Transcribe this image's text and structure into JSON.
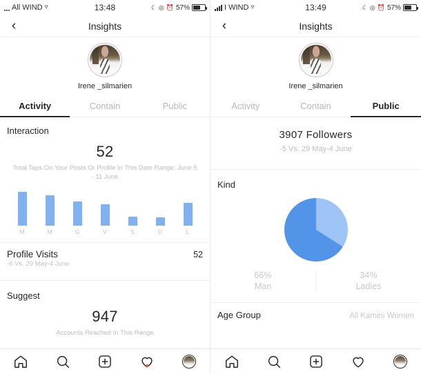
{
  "left": {
    "status": {
      "carrier": "All WIND",
      "wifi_icon": "wifi-icon",
      "time": "13:48",
      "moon_icon": "moon-icon",
      "location_icon": "location-icon",
      "alarm_icon": "alarm-icon",
      "battery_pct": "57%"
    },
    "nav": {
      "back_icon": "chevron-left-icon",
      "title": "Insights"
    },
    "profile": {
      "handle": "Irene _silmarien",
      "avatar_icon": "avatar"
    },
    "tabs": [
      {
        "label": "Activity",
        "active": true
      },
      {
        "label": "Contain",
        "active": false
      },
      {
        "label": "Public",
        "active": false
      }
    ],
    "interaction": {
      "title": "Interaction",
      "value": "52",
      "caption": "Total Taps On Your Posts Or Profile In This Date Range: June 5 - 11 June"
    },
    "profile_visits": {
      "title": "Profile Visits",
      "value": "52",
      "sub": "-6 Vs. 29 May-4 June"
    },
    "suggest": {
      "title": "Suggest",
      "value": "947",
      "caption": "Accounts Reached In This Range"
    }
  },
  "right": {
    "status": {
      "carrier": "I WIND",
      "wifi_icon": "wifi-icon",
      "time": "13:49",
      "moon_icon": "moon-icon",
      "location_icon": "location-icon",
      "alarm_icon": "alarm-icon",
      "battery_pct": "57%"
    },
    "nav": {
      "back_icon": "chevron-left-icon",
      "title": "Insights"
    },
    "profile": {
      "handle": "Irene _silmarien",
      "avatar_icon": "avatar"
    },
    "tabs": [
      {
        "label": "Activity",
        "active": false
      },
      {
        "label": "Contain",
        "active": false
      },
      {
        "label": "Public",
        "active": true
      }
    ],
    "followers": {
      "value": "3907 Followers",
      "sub": "-5 Vs. 29 May-4 June"
    },
    "kind": {
      "title": "Kind"
    },
    "legend": [
      {
        "pct": "66%",
        "label": "Man"
      },
      {
        "pct": "34%",
        "label": "Ladies"
      }
    ],
    "age_group": {
      "title": "Age Group",
      "value": "All Kamini Women"
    }
  },
  "tabbar": {
    "items": [
      {
        "icon": "home-icon",
        "badge": false
      },
      {
        "icon": "search-icon",
        "badge": false
      },
      {
        "icon": "add-post-icon",
        "badge": false
      },
      {
        "icon": "heart-icon",
        "badge": true
      },
      {
        "icon": "profile-avatar-icon",
        "badge": false
      }
    ]
  },
  "colors": {
    "bar_blue": "#7fb2ef",
    "pie_dark": "#5294e8",
    "pie_light": "#9dc4f5",
    "text_primary": "#262626",
    "text_muted": "#c4c4c4",
    "badge_red": "#e8563f"
  },
  "chart_data": [
    {
      "type": "bar",
      "title": "Interaction",
      "categories": [
        "M",
        "M",
        "G",
        "V",
        "S",
        "D",
        "L"
      ],
      "values": [
        52,
        47,
        37,
        33,
        14,
        13,
        35
      ],
      "xlabel": "",
      "ylabel": "",
      "ylim": [
        0,
        55
      ],
      "grid": false,
      "legend": "none",
      "annotations": [
        "52 Total Taps On Your Posts Or Profile In This Date Range: June 5 - 11 June"
      ]
    },
    {
      "type": "pie",
      "title": "Kind",
      "categories": [
        "Man",
        "Ladies"
      ],
      "values": [
        66,
        34
      ],
      "labels": [
        "66%",
        "34%"
      ],
      "legend": "bottom",
      "annotations": [
        "3907 Followers",
        "-5 Vs. 29 May-4 June"
      ]
    }
  ]
}
